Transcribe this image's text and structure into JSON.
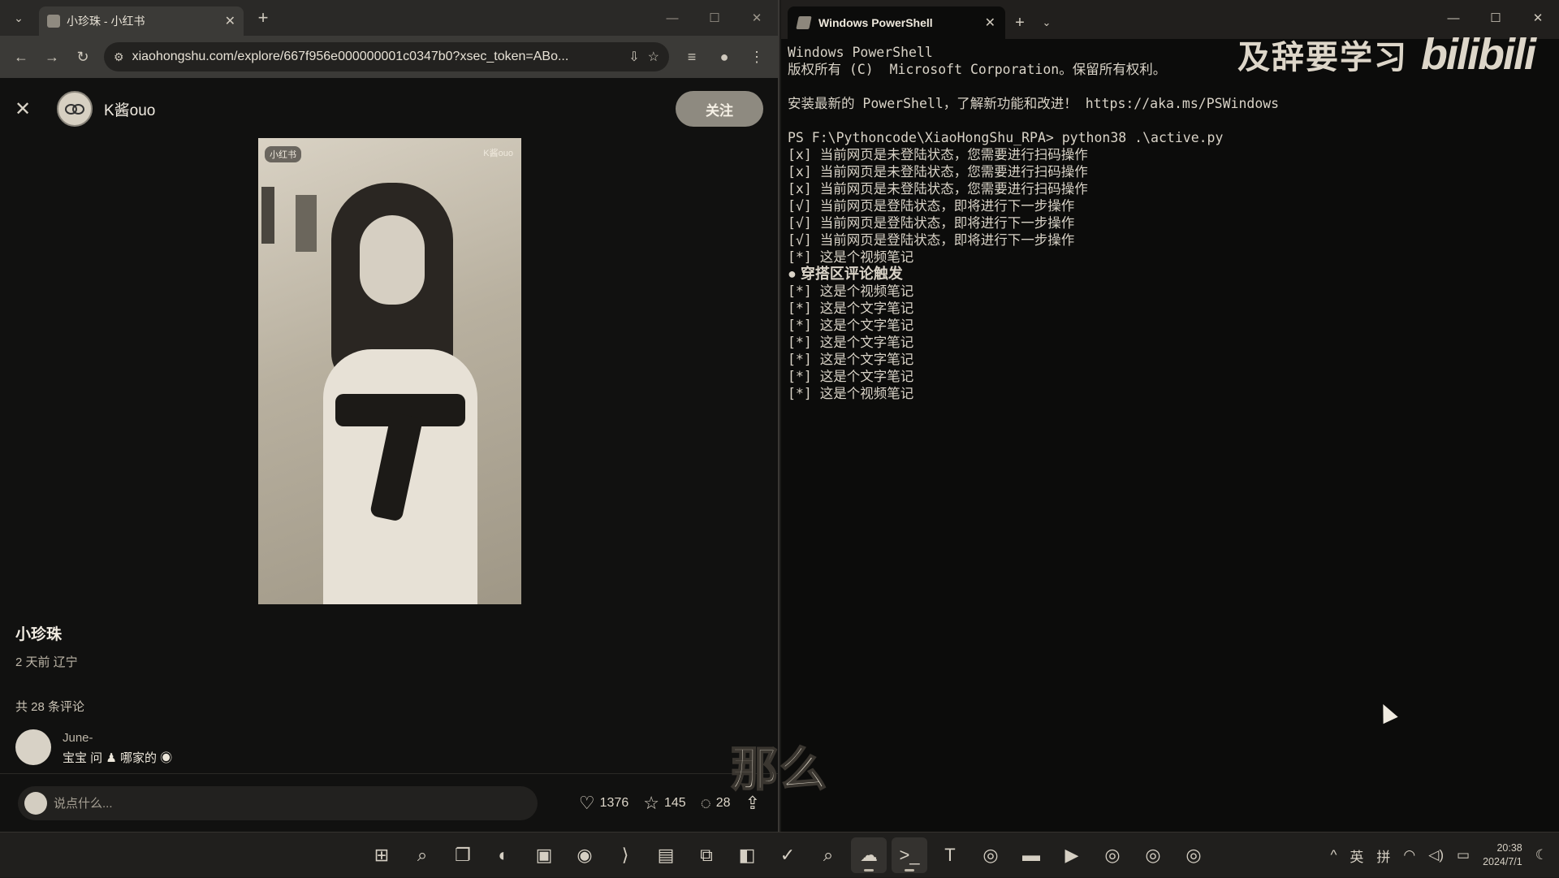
{
  "browser": {
    "tab_title": "小珍珠 - 小红书",
    "url": "xiaohongshu.com/explore/667f956e000000001c0347b0?xsec_token=ABo...",
    "note": {
      "author_name": "K酱ouo",
      "follow_label": "关注",
      "image_watermark_left": "小红书",
      "image_watermark_right": "K酱ouo",
      "title": "小珍珠",
      "meta": "2 天前 辽宁",
      "comment_count": "共 28 条评论",
      "first_comment": {
        "user": "June-",
        "text": "宝宝 问 ♟ 哪家的 ◉"
      },
      "input_placeholder": "说点什么...",
      "likes": "1376",
      "collects": "145",
      "comments": "28"
    },
    "overlay_caption": "那么"
  },
  "powershell": {
    "tab_title": "Windows PowerShell",
    "watermark_text": "及辞要学习",
    "watermark_logo": "bilibili",
    "lines": [
      {
        "text": "Windows PowerShell"
      },
      {
        "text": "版权所有 (C)  Microsoft Corporation。保留所有权利。"
      },
      {
        "text": ""
      },
      {
        "text": "安装最新的 PowerShell，了解新功能和改进！ https://aka.ms/PSWindows"
      },
      {
        "text": ""
      },
      {
        "text": "PS F:\\Pythoncode\\XiaoHongShu_RPA> python38 .\\active.py"
      },
      {
        "text": "[x] 当前网页是未登陆状态，您需要进行扫码操作"
      },
      {
        "text": "[x] 当前网页是未登陆状态，您需要进行扫码操作"
      },
      {
        "text": "[x] 当前网页是未登陆状态，您需要进行扫码操作"
      },
      {
        "text": "[√] 当前网页是登陆状态，即将进行下一步操作"
      },
      {
        "text": "[√] 当前网页是登陆状态，即将进行下一步操作"
      },
      {
        "text": "[√] 当前网页是登陆状态，即将进行下一步操作"
      },
      {
        "text": "[*] 这是个视频笔记"
      },
      {
        "text": "● 穿搭区评论触发",
        "bold": true
      },
      {
        "text": "[*] 这是个视频笔记"
      },
      {
        "text": "[*] 这是个文字笔记"
      },
      {
        "text": "[*] 这是个文字笔记"
      },
      {
        "text": "[*] 这是个文字笔记"
      },
      {
        "text": "[*] 这是个文字笔记"
      },
      {
        "text": "[*] 这是个文字笔记"
      },
      {
        "text": "[*] 这是个视频笔记"
      }
    ]
  },
  "taskbar": {
    "apps": [
      {
        "name": "start-icon",
        "glyph": "⊞"
      },
      {
        "name": "search-icon",
        "glyph": "⌕"
      },
      {
        "name": "task-view-icon",
        "glyph": "❐"
      },
      {
        "name": "edge-icon",
        "glyph": "◐"
      },
      {
        "name": "app-icon",
        "glyph": "▣"
      },
      {
        "name": "music-icon",
        "glyph": "◉"
      },
      {
        "name": "vscode-icon",
        "glyph": "⟩"
      },
      {
        "name": "notes-icon",
        "glyph": "▤"
      },
      {
        "name": "copy-icon",
        "glyph": "⧉"
      },
      {
        "name": "office-icon",
        "glyph": "◧"
      },
      {
        "name": "check-icon",
        "glyph": "✓"
      },
      {
        "name": "search2-icon",
        "glyph": "⌕"
      },
      {
        "name": "wechat-icon",
        "glyph": "☁",
        "active": true
      },
      {
        "name": "terminal-icon",
        "glyph": ">_",
        "active": true
      },
      {
        "name": "typora-icon",
        "glyph": "T"
      },
      {
        "name": "chrome-icon",
        "glyph": "◎"
      },
      {
        "name": "explorer-icon",
        "glyph": "▬"
      },
      {
        "name": "player-icon",
        "glyph": "▶"
      },
      {
        "name": "chrome2-icon",
        "glyph": "◎"
      },
      {
        "name": "chrome3-icon",
        "glyph": "◎"
      },
      {
        "name": "chrome4-icon",
        "glyph": "◎"
      }
    ],
    "tray": {
      "lang1": "英",
      "lang2": "拼",
      "time": "20:38",
      "date": "2024/7/1"
    }
  }
}
